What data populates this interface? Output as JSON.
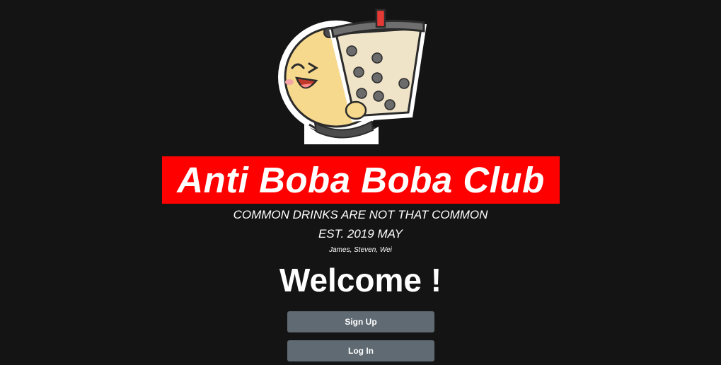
{
  "brand": {
    "title": "Anti Boba Boba Club",
    "tagline": "COMMON DRINKS ARE NOT THAT COMMON",
    "established": "EST. 2019 MAY",
    "founders": "James, Steven, Wei",
    "banner_color": "#ff0000",
    "background_color": "#141414"
  },
  "mascot": {
    "icon": "boba-mascot-icon"
  },
  "welcome": {
    "heading": "Welcome !"
  },
  "actions": {
    "signup_label": "Sign Up",
    "login_label": "Log In",
    "button_color": "#5f6a72"
  }
}
